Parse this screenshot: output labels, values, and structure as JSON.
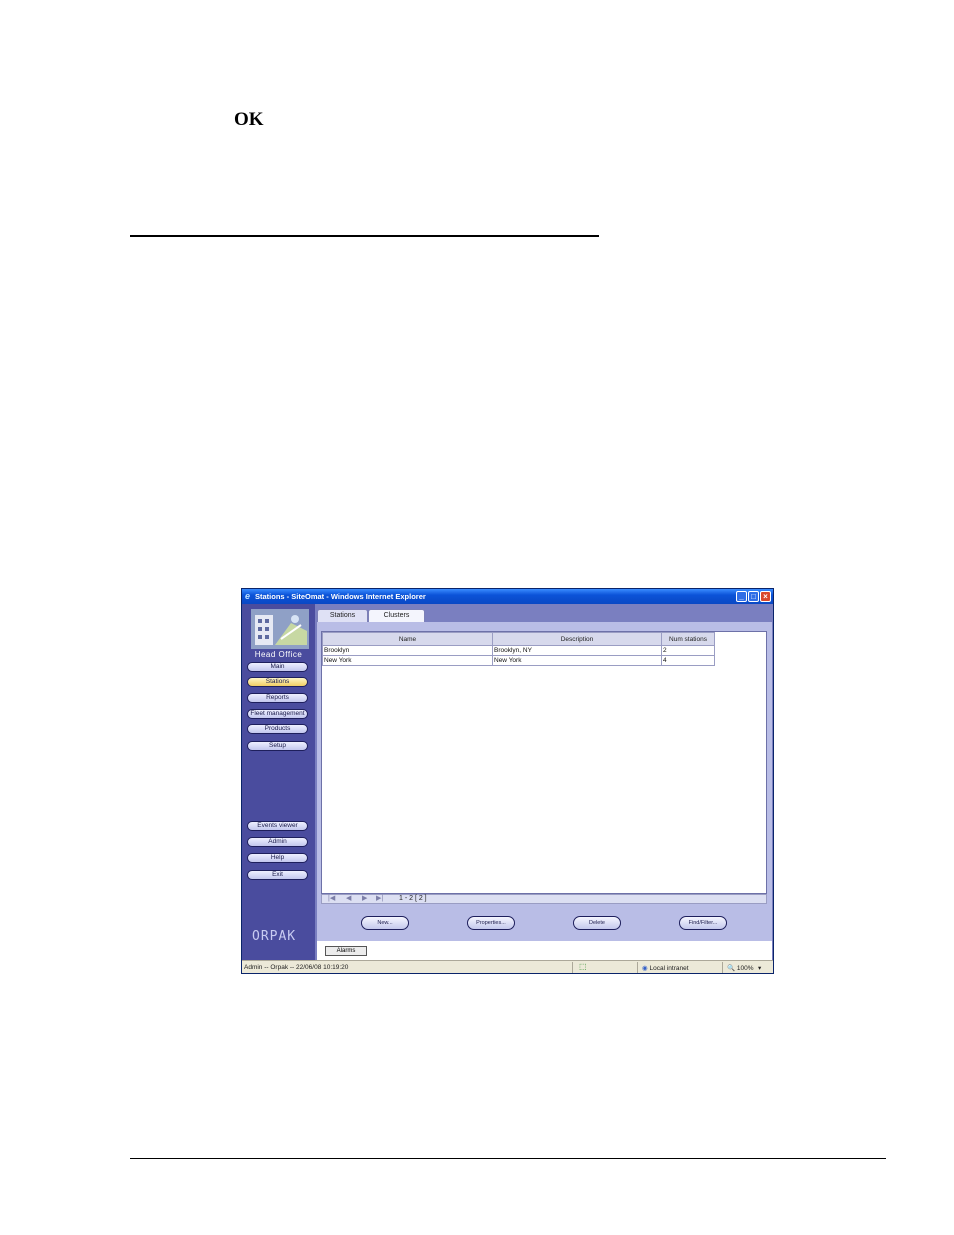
{
  "document": {
    "ok_label": "OK"
  },
  "window": {
    "title": "Stations - SiteOmat - Windows Internet Explorer"
  },
  "sidebar": {
    "heading": "Head Office",
    "items": [
      {
        "label": "Main"
      },
      {
        "label": "Stations"
      },
      {
        "label": "Reports"
      },
      {
        "label": "Fleet management"
      },
      {
        "label": "Products"
      },
      {
        "label": "Setup"
      },
      {
        "label": "Events viewer"
      },
      {
        "label": "Admin"
      },
      {
        "label": "Help"
      },
      {
        "label": "Exit"
      }
    ],
    "brand": "ORPAK"
  },
  "tabs": [
    {
      "label": "Stations"
    },
    {
      "label": "Clusters"
    }
  ],
  "grid": {
    "columns": [
      "Name",
      "Description",
      "Num stations"
    ],
    "rows": [
      [
        "Brooklyn",
        "Brooklyn, NY",
        "2"
      ],
      [
        "New York",
        "New York",
        "4"
      ]
    ]
  },
  "pager": {
    "range": "1 - 2  [ 2 ]"
  },
  "actions": {
    "new": "New...",
    "properties": "Properties...",
    "delete": "Delete",
    "find": "Find/Filter..."
  },
  "alarms": {
    "label": "Alarms"
  },
  "statusbar": {
    "left": "Admin -- Orpak -- 22/06/08  10:19:20",
    "zone": "Local intranet",
    "zoom": "100%"
  },
  "colors": {
    "accent": "#0b53d8",
    "sidebar": "#4a4c9e",
    "active_item": "#f1cf63"
  }
}
